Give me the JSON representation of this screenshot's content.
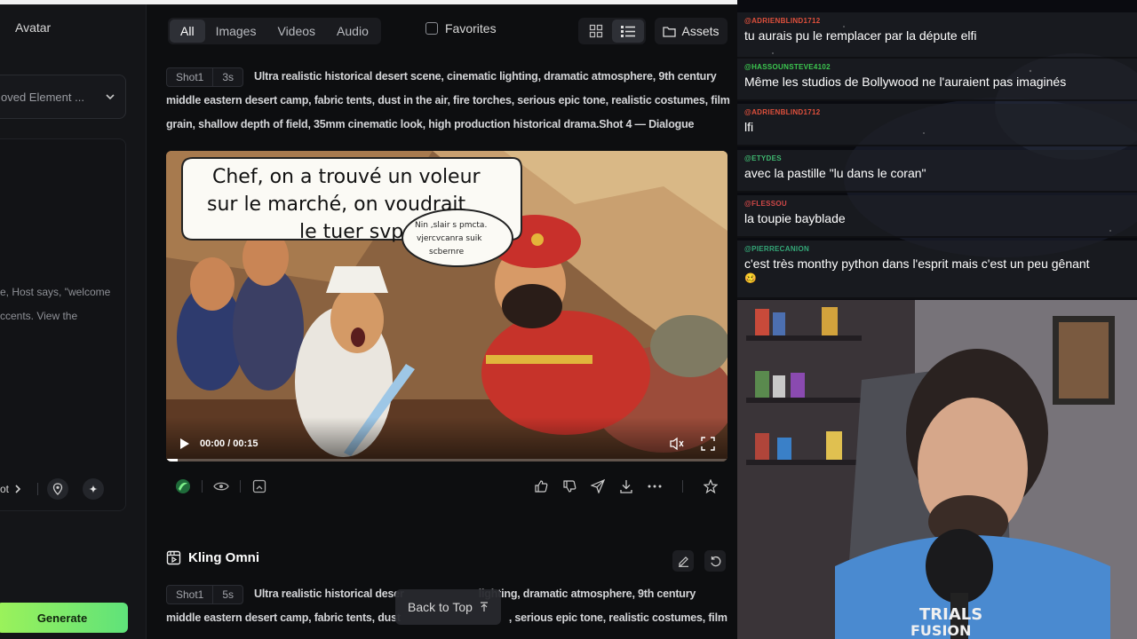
{
  "sidebar": {
    "title": "Avatar",
    "select_text": "oved Element ...",
    "description_lines": [
      "e, Host says, \"welcome",
      "ccents. View the"
    ],
    "shot_label": "ot",
    "generate_label": "Generate"
  },
  "toolbar": {
    "tabs": [
      {
        "label": "All",
        "active": true
      },
      {
        "label": "Images",
        "active": false
      },
      {
        "label": "Videos",
        "active": false
      },
      {
        "label": "Audio",
        "active": false
      }
    ],
    "favorites_label": "Favorites",
    "assets_label": "Assets"
  },
  "item1": {
    "shot_label": "Shot1",
    "duration": "3s",
    "prompt_lines": [
      "Ultra realistic historical desert scene, cinematic lighting, dramatic atmosphere, 9th century",
      "middle eastern desert camp, fabric tents, dust in the air, fire torches, serious epic tone, realistic costumes, film",
      "grain, shallow depth of field, 35mm cinematic look, high production historical drama.Shot 4 — Dialogue"
    ],
    "video": {
      "speech_big": [
        "Chef, on a trouvé un voleur",
        "sur le marché, on voudrait",
        "le tuer svp"
      ],
      "speech_small": [
        "Nin ,slair s pmcta.",
        "vjercvcanra suik",
        "scbernre"
      ],
      "time": "00:00 / 00:15",
      "progress": 0.02
    }
  },
  "item2": {
    "title": "Kling Omni",
    "shot_label": "Shot1",
    "duration": "5s",
    "prompt_lines": [
      "Ultra realistic historical deser",
      "lighting, dramatic atmosphere, 9th century",
      "middle eastern desert camp, fabric tents, dust",
      ", serious epic tone, realistic costumes, film"
    ]
  },
  "back_to_top_label": "Back to Top",
  "chat": {
    "messages": [
      {
        "user": "@ADRIENBLIND1712",
        "color": "#e0503c",
        "text": "tu aurais pu le remplacer par la députe elfi"
      },
      {
        "user": "@HASSOUNSTEVE4102",
        "color": "#3cc850",
        "text": "Même les studios de Bollywood ne l'auraient pas imaginés"
      },
      {
        "user": "@ADRIENBLIND1712",
        "color": "#e0503c",
        "text": "lfi"
      },
      {
        "user": "@ETYDES",
        "color": "#3fb870",
        "text": "avec la pastille \"lu dans le coran\""
      },
      {
        "user": "@FLESSOU",
        "color": "#d04848",
        "text": "la toupie bayblade"
      },
      {
        "user": "@PIERRECANION",
        "color": "#34a878",
        "text": "c'est très monthy python dans l'esprit mais c'est un peu gênant",
        "emoji": "🥴"
      }
    ]
  },
  "webcam": {
    "shirt_text": [
      "TRIALS",
      "FUSION"
    ]
  }
}
